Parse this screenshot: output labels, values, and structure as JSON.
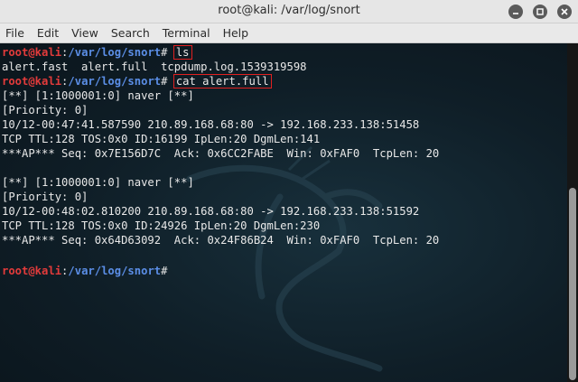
{
  "window": {
    "title": "root@kali: /var/log/snort"
  },
  "menubar": {
    "items": [
      "File",
      "Edit",
      "View",
      "Search",
      "Terminal",
      "Help"
    ]
  },
  "terminal": {
    "prompt": {
      "user": "root@kali",
      "sep": ":",
      "path": "/var/log/snort",
      "symbol": "# "
    },
    "cmd1": "ls",
    "ls_output": "alert.fast  alert.full  tcpdump.log.1539319598",
    "cmd2": "cat alert.full",
    "alert1": {
      "header": "[**] [1:1000001:0] naver [**]",
      "priority": "[Priority: 0]",
      "flow": "10/12-00:47:41.587590 210.89.168.68:80 -> 192.168.233.138:51458",
      "ip": "TCP TTL:128 TOS:0x0 ID:16199 IpLen:20 DgmLen:141",
      "tcp": "***AP*** Seq: 0x7E156D7C  Ack: 0x6CC2FABE  Win: 0xFAF0  TcpLen: 20"
    },
    "alert2": {
      "header": "[**] [1:1000001:0] naver [**]",
      "priority": "[Priority: 0]",
      "flow": "10/12-00:48:02.810200 210.89.168.68:80 -> 192.168.233.138:51592",
      "ip": "TCP TTL:128 TOS:0x0 ID:24926 IpLen:20 DgmLen:230",
      "tcp": "***AP*** Seq: 0x64D63092  Ack: 0x24F86B24  Win: 0xFAF0  TcpLen: 20"
    }
  },
  "colors": {
    "prompt_user": "#e33b3b",
    "prompt_path": "#5b8ee6",
    "highlight_box": "#e02020",
    "text": "#e8e8e8"
  },
  "icons": [
    "minimize-icon",
    "maximize-icon",
    "close-icon",
    "kali-dragon-icon"
  ]
}
